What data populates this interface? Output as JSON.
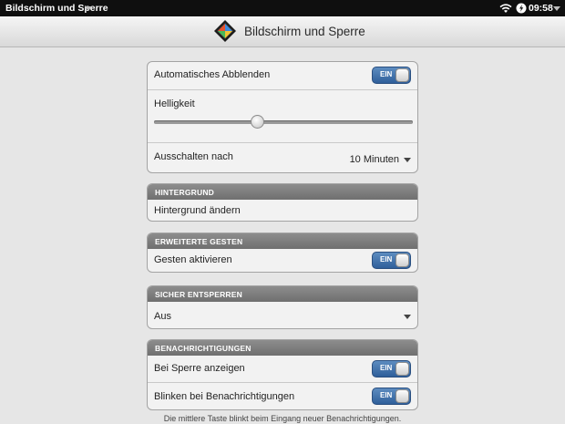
{
  "statusbar": {
    "app_title": "Bildschirm und Sperre",
    "time": "09:58"
  },
  "header": {
    "title": "Bildschirm und Sperre"
  },
  "display": {
    "auto_dim_label": "Automatisches Abblenden",
    "auto_dim_toggle": "EIN",
    "brightness_label": "Helligkeit",
    "brightness_level": 0.4,
    "turn_off_label": "Ausschalten nach",
    "turn_off_value": "10 Minuten"
  },
  "wallpaper": {
    "header": "HINTERGRUND",
    "change_label": "Hintergrund ändern"
  },
  "gestures": {
    "header": "ERWEITERTE GESTEN",
    "enable_label": "Gesten aktivieren",
    "enable_toggle": "EIN"
  },
  "secure_unlock": {
    "header": "SICHER ENTSPERREN",
    "value": "Aus"
  },
  "notifications": {
    "header": "BENACHRICHTIGUNGEN",
    "show_locked_label": "Bei Sperre anzeigen",
    "show_locked_toggle": "EIN",
    "blink_label": "Blinken bei Benachrichtigungen",
    "blink_toggle": "EIN",
    "note": "Die mittlere Taste blinkt beim Eingang neuer Benachrichtigungen."
  },
  "colors": {
    "toggle_blue": "#3b6ca6",
    "group_header": "#7c7c7c",
    "background": "#e6e6e6"
  },
  "icons": [
    "chevron-down-icon",
    "wifi-icon",
    "battery-icon",
    "screen-lock-app-icon"
  ]
}
